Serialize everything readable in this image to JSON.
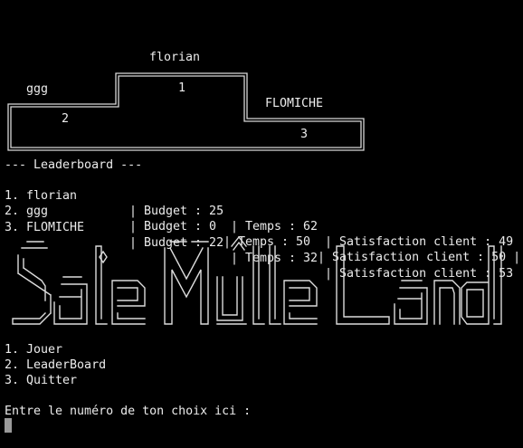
{
  "podium": {
    "first": {
      "name": "florian",
      "rank": "1"
    },
    "second": {
      "name": "ggg",
      "rank": "2"
    },
    "third": {
      "name": "FLOMICHE",
      "rank": "3"
    }
  },
  "leaderboard": {
    "header": "--- Leaderboard ---",
    "rows": [
      {
        "rank_name": "1. florian",
        "budget": "| Budget : 25",
        "temps": "| Temps : 62",
        "satisfaction": "| Satisfaction client : 49 |"
      },
      {
        "rank_name": "2. ggg",
        "budget": "| Budget : 0",
        "temps": "| Temps : 50",
        "satisfaction": "| Satisfaction client : 50 |"
      },
      {
        "rank_name": "3. FLOMICHE",
        "budget": "| Budget : 22",
        "temps": "| Temps : 32",
        "satisfaction": "| Satisfaction client : 53 |"
      }
    ]
  },
  "banner": {
    "text": "SaleMulleLand",
    "style": "ascii-art"
  },
  "menu": {
    "items": [
      "1. Jouer",
      "2. LeaderBoard",
      "3. Quitter"
    ]
  },
  "prompt": "Entre le numéro de ton choix ici :",
  "colors": {
    "background": "#000000",
    "foreground": "#ececec",
    "cursor": "#9a9a9a"
  }
}
